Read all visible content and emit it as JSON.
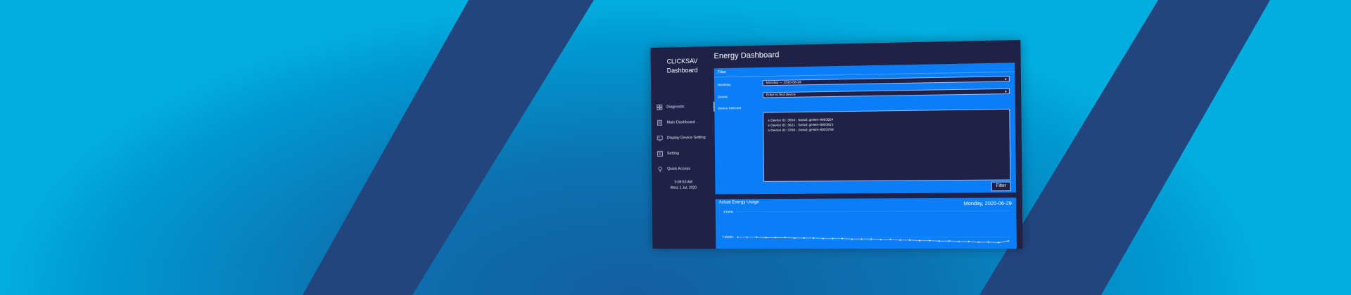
{
  "app": {
    "brand_line1": "CLICKSAV",
    "brand_line2": "Dashboard",
    "page_title": "Energy Dashboard"
  },
  "sidebar": {
    "items": [
      {
        "label": "Diagnostic",
        "icon": "grid-icon",
        "active": true
      },
      {
        "label": "Main Dashboard",
        "icon": "document-icon",
        "active": false
      },
      {
        "label": "Display Device Setting",
        "icon": "display-icon",
        "active": false
      },
      {
        "label": "Setting",
        "icon": "settings-panel-icon",
        "active": false
      },
      {
        "label": "Quick Access",
        "icon": "lightbulb-icon",
        "active": false
      }
    ],
    "clock_time": "5:08:53 AM",
    "clock_date": "Wed, 1 Jul, 2020"
  },
  "filter": {
    "title": "Filter",
    "weekday_label": "Weekday",
    "weekday_value": "Monday --- 2020-06-29",
    "device_label": "Device",
    "device_placeholder": "Enter to find device",
    "selected_label": "Device Selected",
    "selected_devices": [
      "x Device ID: 3554 - Serial: gHWA-8003554",
      "x Device ID: 3621 - Serial: gHWA-8003621",
      "x Device ID: 3769 - Serial: gHWA-8003769"
    ],
    "button_label": "Filter"
  },
  "chart_panel": {
    "title": "Actual Energy Usage",
    "date": "Monday, 2020-06-29"
  },
  "chart_data": {
    "type": "line",
    "title": "Actual Energy Usage",
    "subtitle": "Monday, 2020-06-29",
    "y_tick_labels": [
      "8 kWH",
      "7.5kWH"
    ],
    "ylim": [
      7.3,
      8.0
    ],
    "series": [
      {
        "values": [
          7.5,
          7.5,
          7.5,
          7.49,
          7.49,
          7.49,
          7.48,
          7.48,
          7.48,
          7.47,
          7.47,
          7.47,
          7.46,
          7.46,
          7.46,
          7.45,
          7.45,
          7.44,
          7.44,
          7.43,
          7.43,
          7.42,
          7.42,
          7.41,
          7.41,
          7.4,
          7.4,
          7.39,
          7.42
        ]
      }
    ],
    "grid": true,
    "colors": {
      "line": "#c9cfe0",
      "point": "#eef1ff",
      "grid": "#3f9bfa"
    }
  }
}
